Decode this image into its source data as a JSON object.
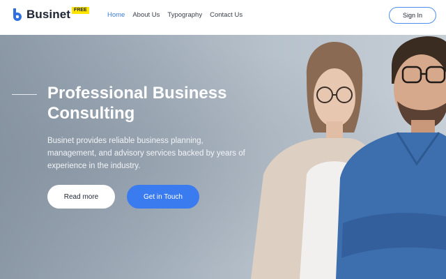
{
  "brand": {
    "name": "Businet",
    "badge": "FREE"
  },
  "nav": {
    "items": [
      {
        "label": "Home",
        "active": true
      },
      {
        "label": "About Us",
        "active": false
      },
      {
        "label": "Typography",
        "active": false
      },
      {
        "label": "Contact Us",
        "active": false
      }
    ]
  },
  "header": {
    "signin_label": "Sign In"
  },
  "hero": {
    "title_line1": "Professional Business",
    "title_line2": "Consulting",
    "desc_line1": "Businet provides reliable business planning,",
    "desc_line2": "management, and advisory services backed by years of",
    "desc_line3": "experience in the industry.",
    "read_more_label": "Read more",
    "get_in_touch_label": "Get in Touch"
  },
  "colors": {
    "accent": "#3b7bf0",
    "nav_active": "#3b7bd8",
    "badge": "#ffe500",
    "text_dark": "#1d2433"
  }
}
